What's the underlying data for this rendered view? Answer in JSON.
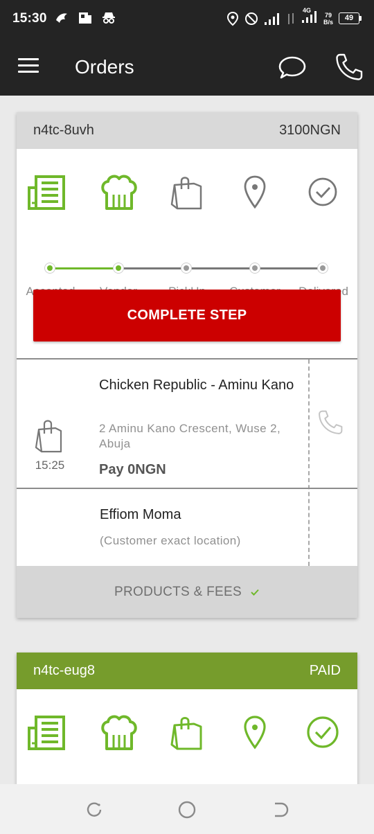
{
  "status_bar": {
    "time": "15:30",
    "left_icons": [
      "app-notification-icon",
      "parking-app-icon",
      "incognito-icon"
    ],
    "right_icons": [
      "location-icon",
      "do-not-disturb-icon",
      "signal-icon",
      "data-activity-icon",
      "signal-4g-icon"
    ],
    "network_type": "4G",
    "data_speed_value": "79",
    "data_speed_unit": "B/s",
    "battery": "49"
  },
  "app_bar": {
    "title": "Orders",
    "icons": [
      "menu-icon",
      "chat-icon",
      "phone-icon"
    ]
  },
  "step_labels": [
    "Accepted",
    "Vendor",
    "PickUp",
    "Customer",
    "Delivered"
  ],
  "colors": {
    "brand_green": "#769c2c",
    "active_green": "#6fb82a",
    "inactive_gray": "#777777",
    "action_red": "#cc0000",
    "app_bar_dark": "#242424"
  },
  "orders": [
    {
      "id": "n4tc-8uvh",
      "header_right": "3100NGN",
      "active_steps": 2,
      "action_button": "COMPLETE STEP",
      "vendor": {
        "name": "Chicken Republic - Aminu Kano",
        "address": "2 Aminu Kano Crescent, Wuse 2, Abuja",
        "time": "15:25",
        "pay": "Pay 0NGN"
      },
      "customer": {
        "name": "Effiom Moma",
        "location": "(Customer exact location)"
      },
      "products_fees_label": "PRODUCTS & FEES"
    },
    {
      "id": "n4tc-eug8",
      "header_right": "PAID",
      "active_steps": 5
    }
  ],
  "nav_bar": {
    "icons": [
      "recent-apps-icon",
      "home-icon",
      "back-icon"
    ]
  }
}
